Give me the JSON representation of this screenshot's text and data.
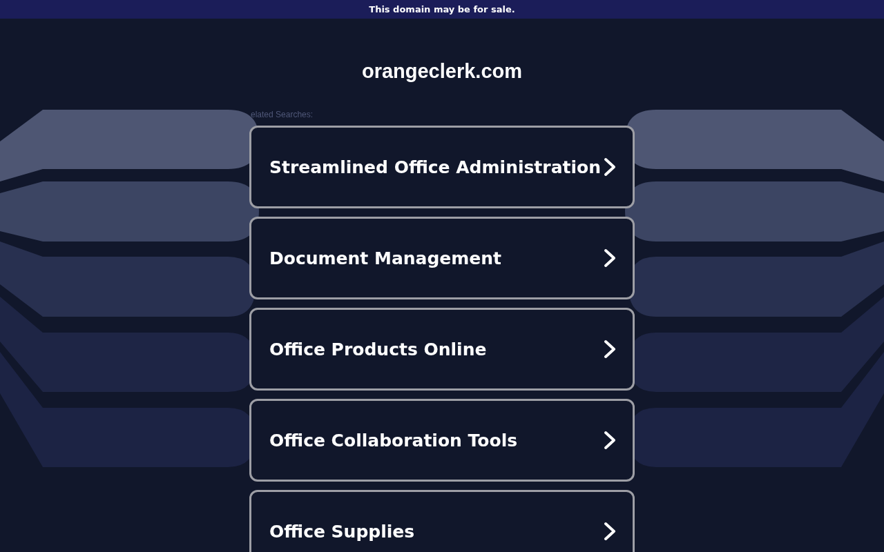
{
  "banner": "This domain may be for sale.",
  "domain": "orangeclerk.com",
  "related_label": "elated Searches:",
  "links": [
    {
      "label": "Streamlined Office Administration"
    },
    {
      "label": "Document Management"
    },
    {
      "label": "Office Products Online"
    },
    {
      "label": "Office Collaboration Tools"
    },
    {
      "label": "Office Supplies"
    }
  ]
}
